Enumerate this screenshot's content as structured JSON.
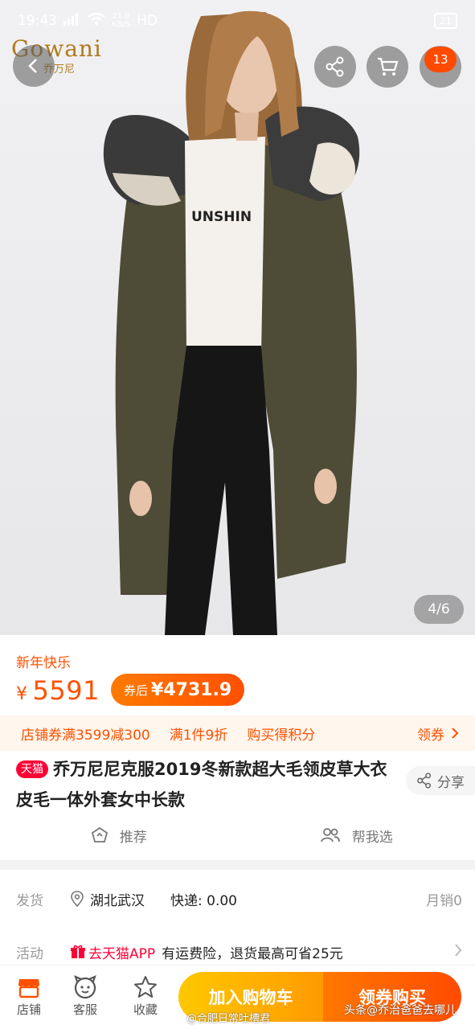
{
  "status_bar": {
    "time": "19:43",
    "signal": "4G",
    "speed": "21.0",
    "speed_unit": "KB/S",
    "hd": "HD",
    "battery": "21"
  },
  "brand": {
    "name": "Gowani",
    "sub": "乔万尼"
  },
  "header": {
    "cart_count": "13",
    "image_page": "4/6",
    "shirt_text": "UNSHIN"
  },
  "icons": {
    "back": "back-arrow-icon",
    "share": "share-icon",
    "cart": "cart-icon",
    "more": "more-icon"
  },
  "product": {
    "promo_label": "新年快乐",
    "currency": "¥",
    "price": "5591",
    "coupon_label": "券后",
    "coupon_price": "¥4731.9",
    "offers": [
      "店铺券满3599减300",
      "满1件9折",
      "购买得积分"
    ],
    "coupon_link": "领券",
    "tmall_tag": "天猫",
    "title": "乔万尼尼克服2019冬新款超大毛领皮草大衣皮毛一体外套女中长款",
    "share_label": "分享",
    "recommend_label": "推荐",
    "help_choose_label": "帮我选"
  },
  "shipping": {
    "ship_label": "发货",
    "location": "湖北武汉",
    "delivery": "快递: 0.00",
    "monthly_sales": "月销0",
    "activity_label": "活动",
    "tmall_app": "去天猫APP",
    "activity_text": "有运费险，退货最高可省25元"
  },
  "bottom_bar": {
    "shop_label": "店铺",
    "service_label": "客服",
    "favorite_label": "收藏",
    "add_cart_label": "加入购物车",
    "buy_label": "领券购买"
  },
  "watermarks": {
    "w1": "@合肥日常吐槽君",
    "w2": "头条@乔治爸爸去哪儿"
  },
  "colors": {
    "accent": "#ff5000",
    "tmall_red": "#ff0036",
    "cart_gradient_start": "#ffc800",
    "buy_gradient_end": "#ff4b00"
  }
}
